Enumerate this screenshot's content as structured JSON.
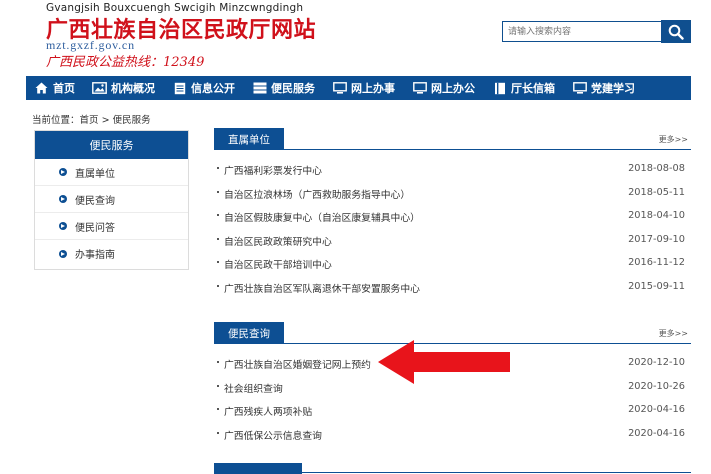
{
  "header": {
    "zhuang_name": "Gvangjsih Bouxcuengh Swcigih Minzcwngdingh",
    "title": "广西壮族自治区民政厅网站",
    "domain": "mzt.gxzf.gov.cn",
    "hotline": "广西民政公益热线：12349"
  },
  "search": {
    "placeholder": "请输入搜索内容"
  },
  "nav": {
    "items": [
      {
        "label": "首页",
        "icon": "home-icon"
      },
      {
        "label": "机构概况",
        "icon": "image-icon"
      },
      {
        "label": "信息公开",
        "icon": "document-icon"
      },
      {
        "label": "便民服务",
        "icon": "tray-icon"
      },
      {
        "label": "网上办事",
        "icon": "monitor-icon"
      },
      {
        "label": "网上办公",
        "icon": "monitor-icon"
      },
      {
        "label": "厅长信箱",
        "icon": "book-icon"
      },
      {
        "label": "党建学习",
        "icon": "monitor-icon"
      }
    ]
  },
  "breadcrumb": {
    "prefix": "当前位置：",
    "home": "首页",
    "sep": ">",
    "current": "便民服务"
  },
  "sidebar": {
    "title": "便民服务",
    "items": [
      {
        "label": "直属单位"
      },
      {
        "label": "便民查询"
      },
      {
        "label": "便民问答"
      },
      {
        "label": "办事指南"
      }
    ]
  },
  "panels": {
    "direct_units": {
      "title": "直属单位",
      "more": "更多>>",
      "rows": [
        {
          "text": "广西福利彩票发行中心",
          "date": "2018-08-08"
        },
        {
          "text": "自治区拉浪林场（广西救助服务指导中心）",
          "date": "2018-05-11"
        },
        {
          "text": "自治区假肢康复中心（自治区康复辅具中心）",
          "date": "2018-04-10"
        },
        {
          "text": "自治区民政政策研究中心",
          "date": "2017-09-10"
        },
        {
          "text": "自治区民政干部培训中心",
          "date": "2016-11-12"
        },
        {
          "text": "广西壮族自治区军队离退休干部安置服务中心",
          "date": "2015-09-11"
        }
      ]
    },
    "convenience_query": {
      "title": "便民查询",
      "more": "更多>>",
      "rows": [
        {
          "text": "广西壮族自治区婚姻登记网上预约",
          "date": "2020-12-10"
        },
        {
          "text": "社会组织查询",
          "date": "2020-10-26"
        },
        {
          "text": "广西残疾人两项补贴",
          "date": "2020-04-16"
        },
        {
          "text": "广西低保公示信息查询",
          "date": "2020-04-16"
        }
      ]
    }
  },
  "colors": {
    "brand_blue": "#0d4f93",
    "title_red": "#d0111b",
    "arrow_red": "#e8141b"
  }
}
